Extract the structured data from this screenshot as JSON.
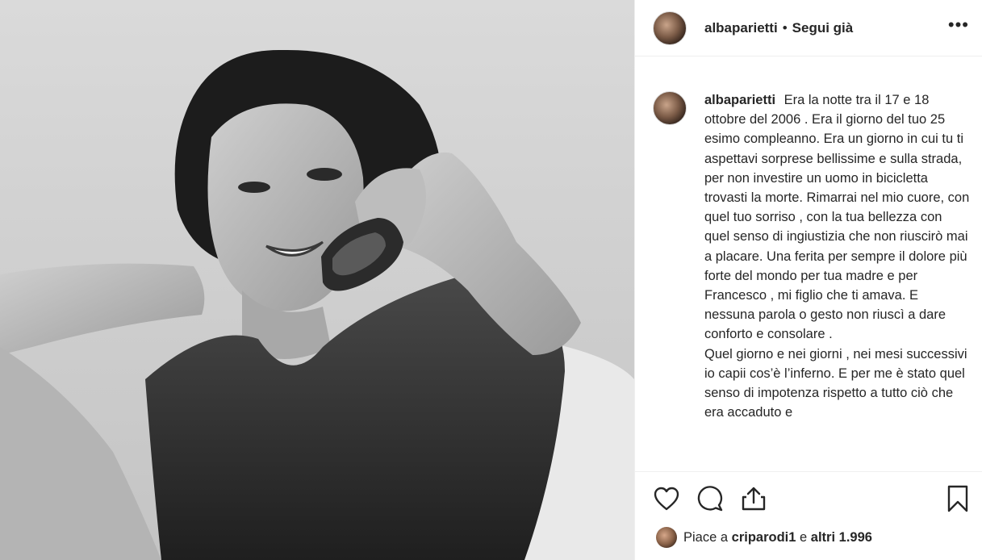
{
  "post": {
    "username": "albaparietti",
    "separator": "•",
    "follow_state": "Segui già",
    "more_label": "•••",
    "caption_paragraphs": [
      "Era la notte tra il 17 e 18 ottobre del 2006 . Era il giorno del tuo 25 esimo compleanno. Era un giorno in cui tu ti aspettavi sorprese bellissime e sulla strada, per non investire un uomo in bicicletta trovasti la morte. Rimarrai nel mio cuore, con quel tuo sorriso , con la tua bellezza con quel senso di ingiustizia che non riuscirò mai a placare. Una ferita per sempre il dolore più forte del mondo per tua madre e per Francesco , mi figlio che ti amava. E nessuna parola o gesto non riuscì a dare conforto e consolare .",
      "Quel giorno e nei giorni , nei mesi successivi io capii cos’è l’inferno. E per me è stato quel senso di impotenza rispetto a tutto ciò che era accaduto e"
    ],
    "likes": {
      "prefix": "Piace a",
      "user": "criparodi1",
      "middle": "e",
      "others": "altri 1.996"
    }
  },
  "icons": {
    "more": "more-icon",
    "like": "heart-icon",
    "comment": "comment-icon",
    "share": "share-icon",
    "save": "bookmark-icon"
  },
  "colors": {
    "text": "#262626",
    "border": "#efefef",
    "muted": "#8e8e8e"
  }
}
